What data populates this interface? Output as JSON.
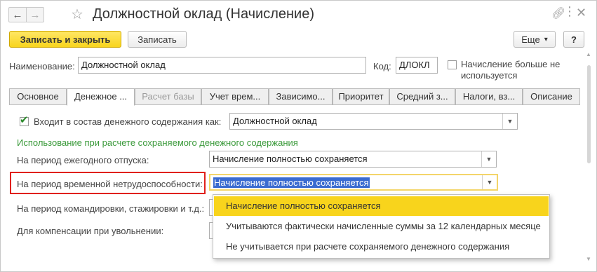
{
  "window": {
    "title": "Должностной оклад (Начисление)"
  },
  "toolbar": {
    "save_close_label": "Записать и закрыть",
    "save_label": "Записать",
    "more_label": "Еще",
    "more_arrow": "▾",
    "help_label": "?"
  },
  "form": {
    "name_label": "Наименование:",
    "name_value": "Должностной оклад",
    "code_label": "Код:",
    "code_value": "ДЛОКЛ",
    "unused_label_line1": "Начисление больше не",
    "unused_label_line2": "используется",
    "unused_checked": false
  },
  "tabs": [
    {
      "label": "Основное",
      "state": "normal"
    },
    {
      "label": "Денежное ...",
      "state": "active"
    },
    {
      "label": "Расчет базы",
      "state": "disabled"
    },
    {
      "label": "Учет врем...",
      "state": "normal"
    },
    {
      "label": "Зависимо...",
      "state": "normal"
    },
    {
      "label": "Приоритет",
      "state": "normal"
    },
    {
      "label": "Средний з...",
      "state": "normal"
    },
    {
      "label": "Налоги, вз...",
      "state": "normal"
    },
    {
      "label": "Описание",
      "state": "normal"
    }
  ],
  "money_tab": {
    "include_label": "Входит в состав денежного содержания как:",
    "include_checked": true,
    "include_value": "Должностной оклад",
    "section_title": "Использование при расчете сохраняемого денежного содержания",
    "vacation_label": "На период ежегодного отпуска:",
    "vacation_value": "Начисление полностью сохраняется",
    "disability_label": "На период временной нетрудоспособности:",
    "disability_value": "Начисление полностью сохраняется",
    "business_trip_label": "На период командировки, стажировки и т.д.:",
    "compensation_label": "Для компенсации при увольнении:"
  },
  "dropdown": {
    "options": [
      "Начисление полностью сохраняется",
      "Учитываются фактически начисленные суммы за 12 календарных месяце",
      "Не учитывается при расчете сохраняемого денежного содержания"
    ],
    "highlighted_index": 0
  },
  "colors": {
    "accent_yellow": "#f8d41c",
    "section_green": "#3b9a3b",
    "highlight_red": "#e0201c",
    "selection_blue": "#3a6bd0"
  }
}
